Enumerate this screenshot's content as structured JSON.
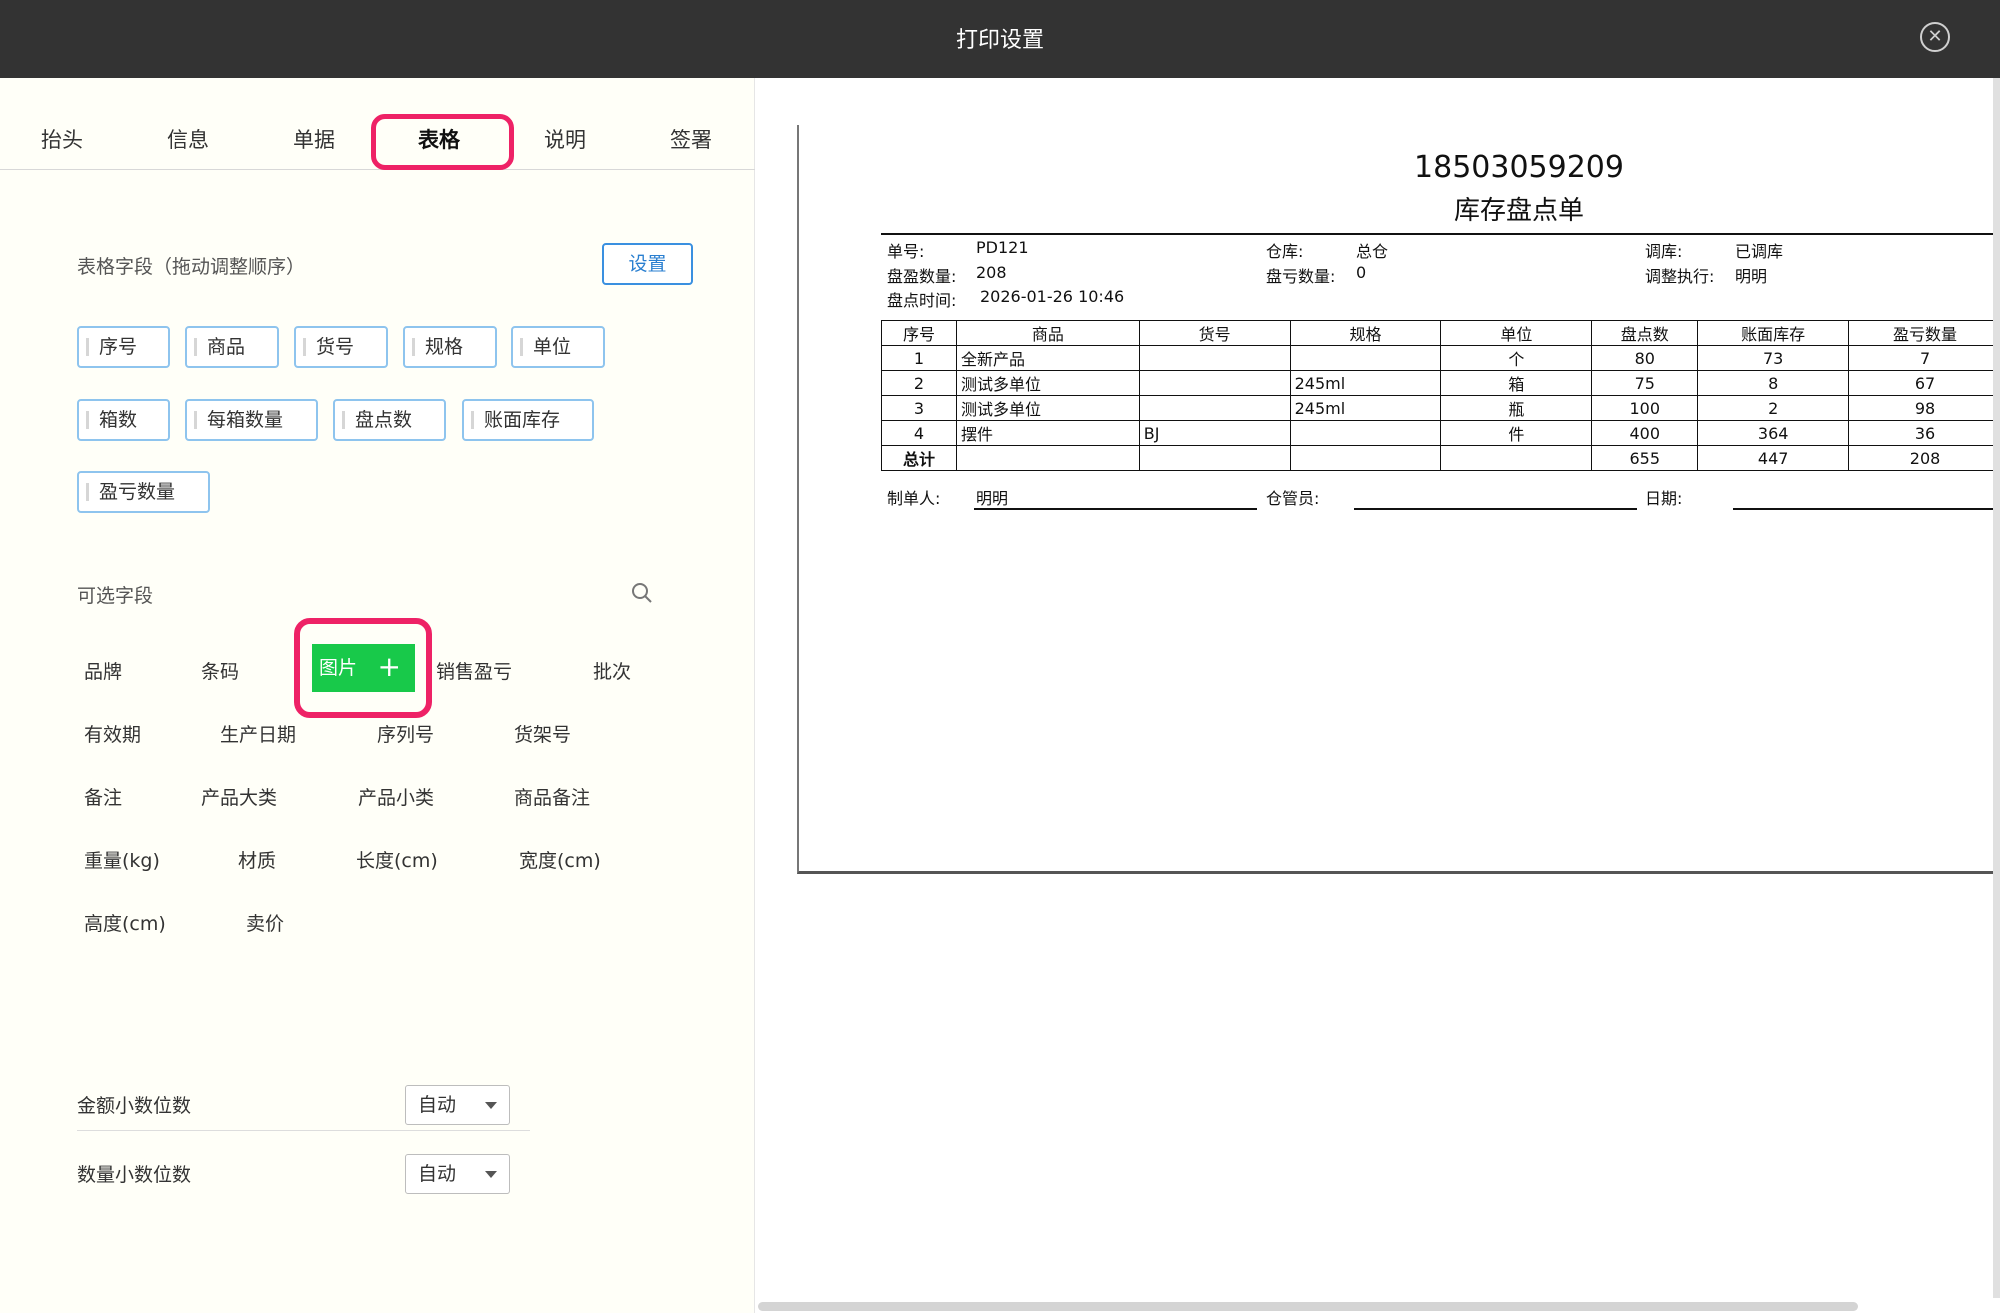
{
  "window": {
    "title": "打印设置",
    "close_glyph": "✕"
  },
  "tabs": [
    "抬头",
    "信息",
    "单据",
    "表格",
    "说明",
    "签署"
  ],
  "active_tab": "表格",
  "table_fields": {
    "label": "表格字段（拖动调整顺序）",
    "settings_label": "设置",
    "chips": [
      "序号",
      "商品",
      "货号",
      "规格",
      "单位",
      "箱数",
      "每箱数量",
      "盘点数",
      "账面库存",
      "盈亏数量"
    ]
  },
  "optional_fields": {
    "label": "可选字段",
    "selected": "图片",
    "items": [
      "品牌",
      "条码",
      "销售盈亏",
      "批次",
      "有效期",
      "生产日期",
      "序列号",
      "货架号",
      "备注",
      "产品大类",
      "产品小类",
      "商品备注",
      "重量(kg)",
      "材质",
      "长度(cm)",
      "宽度(cm)",
      "高度(cm)",
      "卖价"
    ]
  },
  "decimals": {
    "amount_label": "金额小数位数",
    "amount_value": "自动",
    "qty_label": "数量小数位数",
    "qty_value": "自动"
  },
  "document": {
    "phone": "18503059209",
    "title": "库存盘点单",
    "meta": {
      "order_no_label": "单号:",
      "order_no": "PD121",
      "warehouse_label": "仓库:",
      "warehouse": "总仓",
      "adjust_label": "调库:",
      "adjust": "已调库",
      "surplus_label": "盘盈数量:",
      "surplus": "208",
      "loss_label": "盘亏数量:",
      "loss": "0",
      "executor_label": "调整执行:",
      "executor": "明明",
      "time_label": "盘点时间:",
      "time": "2026-01-26 10:46"
    },
    "table": {
      "headers": [
        "序号",
        "商品",
        "货号",
        "规格",
        "单位",
        "盘点数",
        "账面库存",
        "盈亏数量"
      ],
      "rows": [
        [
          "1",
          "全新产品",
          "",
          "",
          "个",
          "80",
          "73",
          "7"
        ],
        [
          "2",
          "测试多单位",
          "",
          "245ml",
          "箱",
          "75",
          "8",
          "67"
        ],
        [
          "3",
          "测试多单位",
          "",
          "245ml",
          "瓶",
          "100",
          "2",
          "98"
        ],
        [
          "4",
          "摆件",
          "BJ",
          "",
          "件",
          "400",
          "364",
          "36"
        ]
      ],
      "total": [
        "总计",
        "",
        "",
        "",
        "",
        "655",
        "447",
        "208"
      ]
    },
    "footer": {
      "maker_label": "制单人:",
      "maker": "明明",
      "keeper_label": "仓管员:",
      "keeper": "",
      "date_label": "日期:",
      "date": ""
    }
  },
  "colors": {
    "titlebar": "#333333",
    "highlight": "#ee2266",
    "accent_blue": "#3a90e0",
    "selected_green": "#18c94a"
  }
}
